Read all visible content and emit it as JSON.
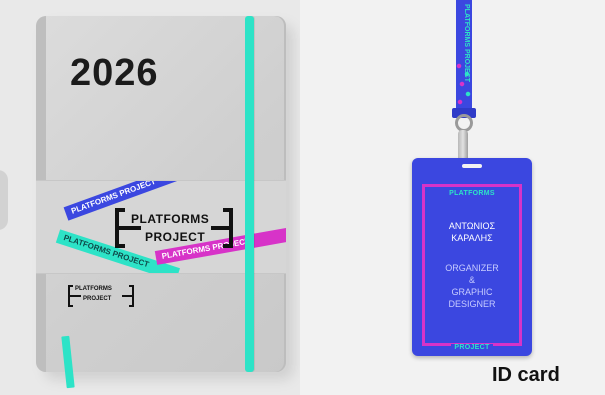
{
  "notebook": {
    "year": "2026",
    "logo_line1": "PLATFORMS",
    "logo_line2": "PROJECT",
    "mini_logo_line1": "PLATFORMS",
    "mini_logo_line2": "PROJECT",
    "ribbon_blue": "PLATFORMS PROJECT",
    "ribbon_teal": "PLATFORMS PROJECT",
    "ribbon_pink": "PLATFORMS PROJECT",
    "elastic_color": "#2de3c7",
    "cover_color": "#d4d4d4"
  },
  "id_card": {
    "lanyard_text": "PLATFORMS PROJECT",
    "top_label": "PLATFORMS",
    "name_line1": "ΑΝΤΩΝΙΟΣ",
    "name_line2": "ΚΑΡΑΛΗΣ",
    "role_line1": "ORGANIZER",
    "role_line2": "&",
    "role_line3": "GRAPHIC",
    "role_line4": "DESIGNER",
    "bottom_label": "PROJECT",
    "caption": "ID card",
    "card_color": "#3b47e0",
    "frame_color": "#d733c8",
    "accent_color": "#2de3c7"
  }
}
